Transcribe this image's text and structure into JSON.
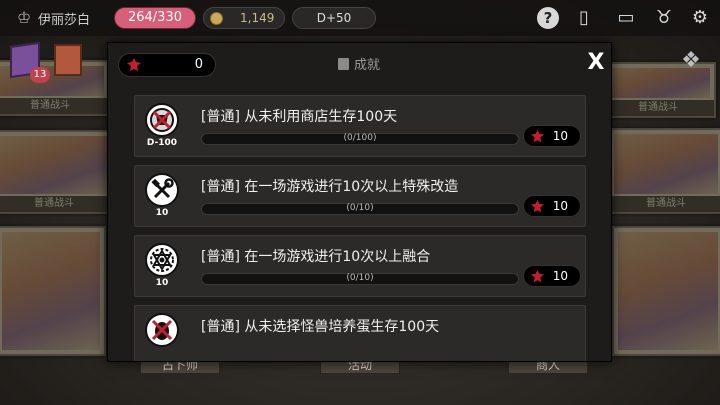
{
  "topbar": {
    "player_name": "伊丽莎白",
    "hp": "264/330",
    "gold": "1,149",
    "day": "D+50"
  },
  "board": {
    "card_captions": [
      "普通战斗",
      "普通战斗",
      "普通战斗",
      "普通战斗"
    ],
    "dice_badge": "13",
    "bottom_labels": [
      "占卜师",
      "活动",
      "商人"
    ]
  },
  "panel": {
    "points": "0",
    "title": "成就",
    "close_label": "X",
    "achievements": [
      {
        "title": "[普通] 从未利用商店生存100天",
        "sub": "D-100",
        "progress": "(0/100)",
        "fraction": 0,
        "reward": "10"
      },
      {
        "title": "[普通] 在一场游戏进行10次以上特殊改造",
        "sub": "10",
        "progress": "(0/10)",
        "fraction": 0,
        "reward": "10"
      },
      {
        "title": "[普通] 在一场游戏进行10次以上融合",
        "sub": "10",
        "progress": "(0/10)",
        "fraction": 0,
        "reward": "10"
      },
      {
        "title": "[普通] 从未选择怪兽培养蛋生存100天",
        "sub": "",
        "progress": "",
        "fraction": 0,
        "reward": ""
      }
    ]
  },
  "colors": {
    "hp_pill": "#d85f7a",
    "panel_bg": "#1d1c1b",
    "row_bg": "#2c2a28",
    "gem_red": "#c2202f"
  }
}
